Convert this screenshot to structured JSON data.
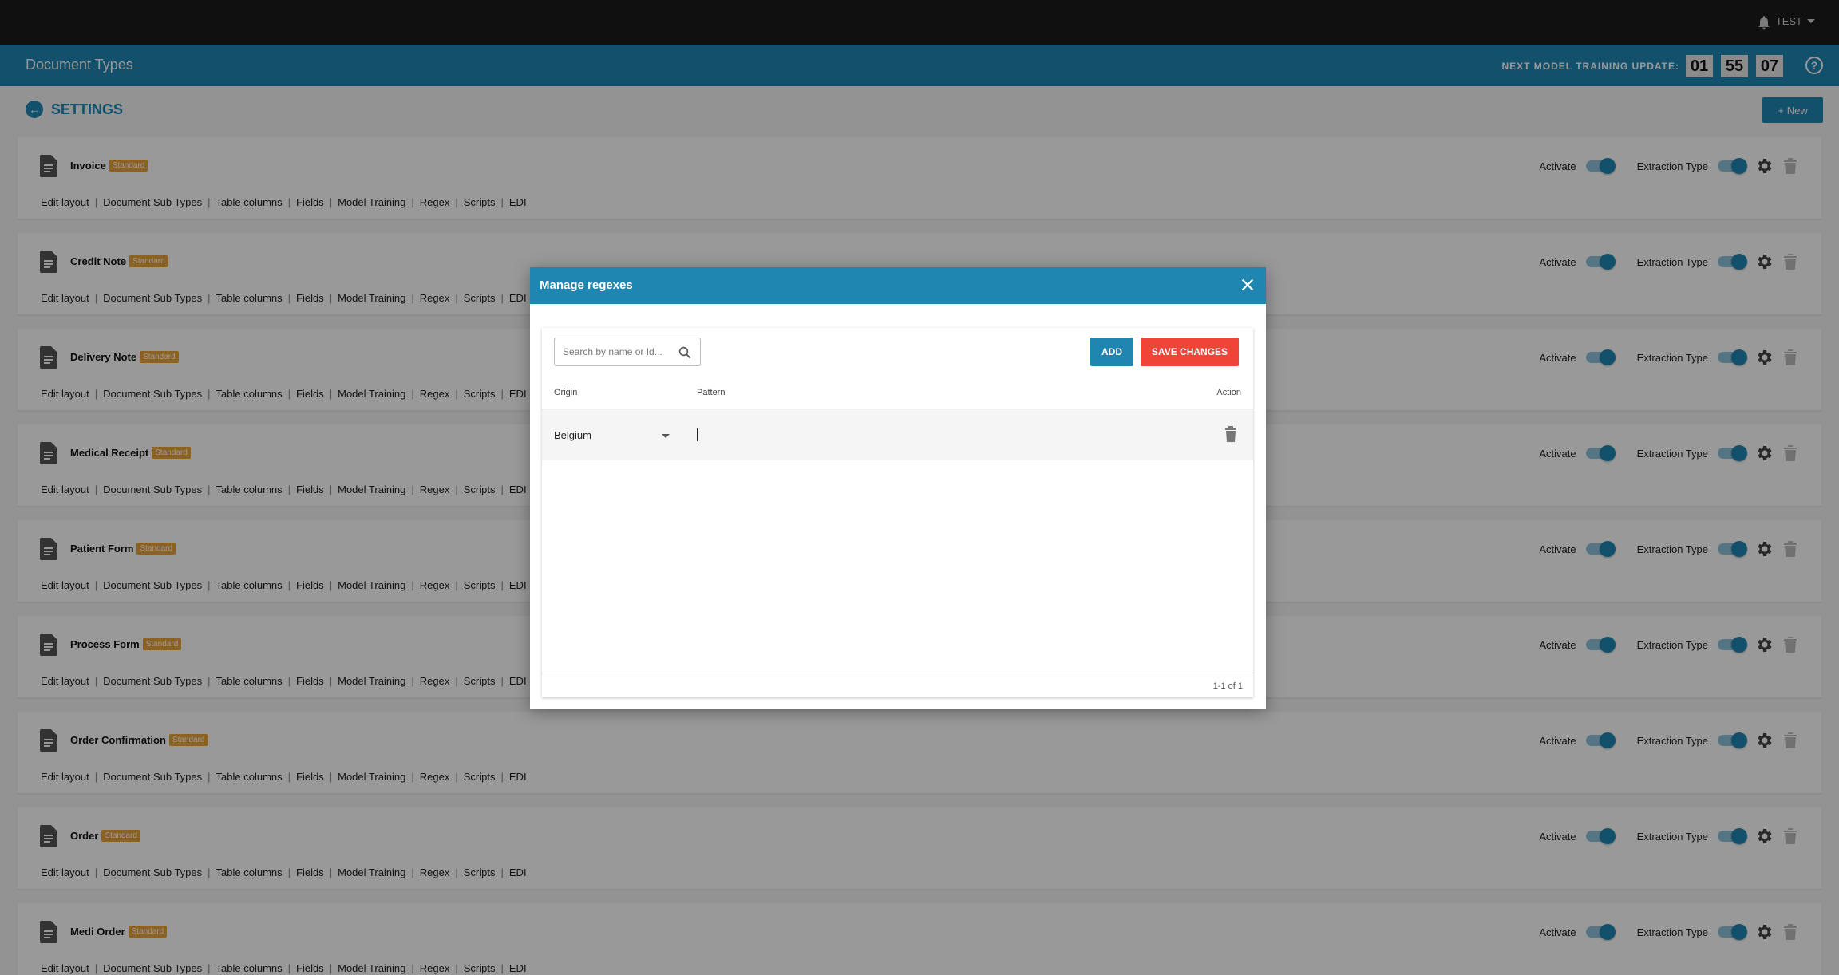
{
  "topbar": {
    "user": "TEST"
  },
  "header": {
    "title": "Document Types",
    "timer_label": "NEXT MODEL TRAINING UPDATE:",
    "timer": {
      "h": "01",
      "m": "55",
      "s": "07"
    },
    "help": "?"
  },
  "settings": {
    "back_label": "SETTINGS",
    "new_label": "New"
  },
  "doc_common": {
    "badge": "Standard",
    "activate": "Activate",
    "extraction": "Extraction Type",
    "links": [
      "Edit layout",
      "Document Sub Types",
      "Table columns",
      "Fields",
      "Model Training",
      "Regex",
      "Scripts",
      "EDI"
    ]
  },
  "documents": [
    {
      "name": "Invoice"
    },
    {
      "name": "Credit Note"
    },
    {
      "name": "Delivery Note"
    },
    {
      "name": "Medical Receipt"
    },
    {
      "name": "Patient Form"
    },
    {
      "name": "Process Form"
    },
    {
      "name": "Order Confirmation"
    },
    {
      "name": "Order"
    },
    {
      "name": "Medi Order"
    }
  ],
  "modal": {
    "title": "Manage regexes",
    "search_placeholder": "Search by name or Id...",
    "add_label": "ADD",
    "save_label": "SAVE CHANGES",
    "columns": {
      "origin": "Origin",
      "pattern": "Pattern",
      "action": "Action"
    },
    "rows": [
      {
        "origin": "Belgium",
        "pattern": ""
      }
    ],
    "pager": "1-1 of 1"
  },
  "colors": {
    "primary": "#1f86b2",
    "danger": "#f04439",
    "badge": "#e8a33a",
    "topbar": "#1c1c1c"
  }
}
